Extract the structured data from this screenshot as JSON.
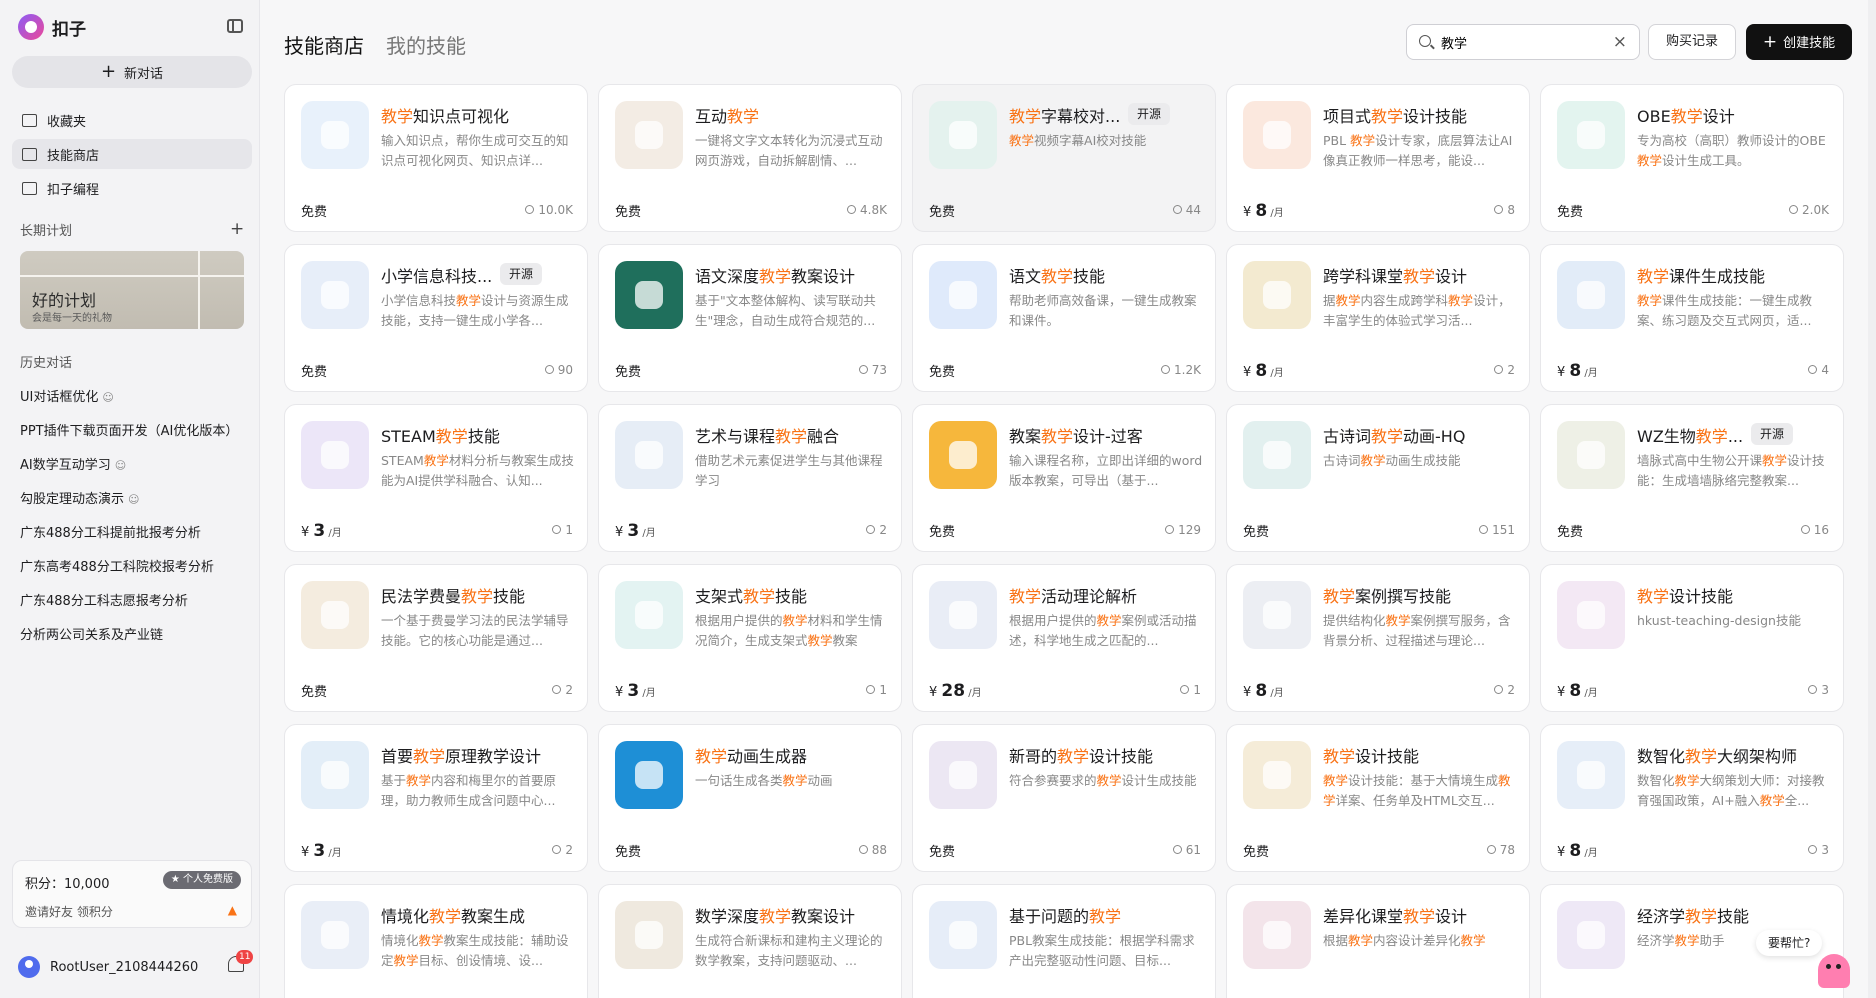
{
  "app": {
    "name": "扣子",
    "new_chat": "新对话"
  },
  "sidebar": {
    "nav": [
      {
        "label": "收藏夹",
        "icon": "folder-icon"
      },
      {
        "label": "技能商店",
        "icon": "books-icon"
      },
      {
        "label": "扣子编程",
        "icon": "code-file-icon"
      }
    ],
    "plan_section": "长期计划",
    "plan_card": {
      "title": "好的计划",
      "subtitle": "会是每一天的礼物"
    },
    "history_section": "历史对话",
    "history": [
      {
        "label": "UI对话框优化",
        "icon": "group-icon"
      },
      {
        "label": "PPT插件下载页面开发（AI优化版本）",
        "icon": ""
      },
      {
        "label": "AI数学互动学习",
        "icon": "group-icon"
      },
      {
        "label": "勾股定理动态演示",
        "icon": "group-icon"
      },
      {
        "label": "广东488分工科提前批报考分析",
        "icon": ""
      },
      {
        "label": "广东高考488分工科院校报考分析",
        "icon": ""
      },
      {
        "label": "广东488分工科志愿报考分析",
        "icon": ""
      },
      {
        "label": "分析两公司关系及产业链",
        "icon": ""
      }
    ],
    "score": {
      "label": "积分：10,000",
      "badge": "★ 个人免费版",
      "invite": "邀请好友 领积分"
    },
    "user": {
      "name": "RootUser_2108444260",
      "notifications": "11"
    }
  },
  "header": {
    "tabs": [
      "技能商店",
      "我的技能"
    ],
    "search": {
      "value": "教学",
      "placeholder": ""
    },
    "purchase_button": "购买记录",
    "create_button": "创建技能"
  },
  "cards": [
    {
      "pre": "",
      "kw": "教学",
      "post": "知识点可视化",
      "tag": "",
      "desc": [
        [
          "",
          "输入知识点，帮你生成可交互的知识点可视化网页、知识点详..."
        ]
      ],
      "price": "免费",
      "users": "10.0K",
      "color": "#e8f1fb",
      "hl": false
    },
    {
      "pre": "互动",
      "kw": "教学",
      "post": "",
      "tag": "",
      "desc": [
        [
          "",
          "一键将文字文本转化为沉浸式互动网页游戏，自动拆解剧情、..."
        ]
      ],
      "price": "免费",
      "users": "4.8K",
      "color": "#f3ece4",
      "hl": false
    },
    {
      "pre": "",
      "kw": "教学",
      "post": "字幕校对...",
      "tag": "开源",
      "desc": [
        [
          "kw",
          "教学"
        ],
        [
          "",
          "视频字幕AI校对技能"
        ]
      ],
      "price": "免费",
      "users": "44",
      "color": "#e4f2ee",
      "hl": true
    },
    {
      "pre": "项目式",
      "kw": "教学",
      "post": "设计技能",
      "tag": "",
      "desc": [
        [
          "",
          "PBL "
        ],
        [
          "kw",
          "教学"
        ],
        [
          "",
          "设计专家，底层算法让AI 像真正教师一样思考，能设..."
        ]
      ],
      "price": "¥|8|/月",
      "users": "8",
      "color": "#fbe8de",
      "hl": false
    },
    {
      "pre": "OBE",
      "kw": "教学",
      "post": "设计",
      "tag": "",
      "desc": [
        [
          "",
          "专为高校（高职）教师设计的OBE"
        ],
        [
          "kw",
          "教学"
        ],
        [
          "",
          "设计生成工具。"
        ]
      ],
      "price": "免费",
      "users": "2.0K",
      "color": "#e3f4ef",
      "hl": false
    },
    {
      "pre": "小学信息科技...",
      "kw": "",
      "post": "",
      "tag": "开源",
      "desc": [
        [
          "",
          "小学信息科技"
        ],
        [
          "kw",
          "教学"
        ],
        [
          "",
          "设计与资源生成技能，支持一键生成小学各..."
        ]
      ],
      "price": "免费",
      "users": "90",
      "color": "#e7eef9",
      "hl": false
    },
    {
      "pre": "语文深度",
      "kw": "教学",
      "post": "教案设计",
      "tag": "",
      "desc": [
        [
          "",
          "基于\"文本整体解构、读写联动共生\"理念，自动生成符合规范的..."
        ]
      ],
      "price": "免费",
      "users": "73",
      "color": "#1f6f5c",
      "hl": false
    },
    {
      "pre": "语文",
      "kw": "教学",
      "post": "技能",
      "tag": "",
      "desc": [
        [
          "",
          "帮助老师高效备课，一键生成教案和课件。"
        ]
      ],
      "price": "免费",
      "users": "1.2K",
      "color": "#dfeafb",
      "hl": false
    },
    {
      "pre": "跨学科课堂",
      "kw": "教学",
      "post": "设计",
      "tag": "",
      "desc": [
        [
          "",
          "据"
        ],
        [
          "kw",
          "教学"
        ],
        [
          "",
          "内容生成跨学科"
        ],
        [
          "kw",
          "教学"
        ],
        [
          "",
          "设计，丰富学生的体验式学习活..."
        ]
      ],
      "price": "¥|8|/月",
      "users": "2",
      "color": "#f3ead0",
      "hl": false
    },
    {
      "pre": "",
      "kw": "教学",
      "post": "课件生成技能",
      "tag": "",
      "desc": [
        [
          "kw",
          "教学"
        ],
        [
          "",
          "课件生成技能：一键生成教案、练习题及交互式网页，适..."
        ]
      ],
      "price": "¥|8|/月",
      "users": "4",
      "color": "#e2ecf8",
      "hl": false
    },
    {
      "pre": "STEAM",
      "kw": "教学",
      "post": "技能",
      "tag": "",
      "desc": [
        [
          "",
          "STEAM"
        ],
        [
          "kw",
          "教学"
        ],
        [
          "",
          "材料分析与教案生成技能为AI提供学科融合、认知..."
        ]
      ],
      "price": "¥|3|/月",
      "users": "1",
      "color": "#ece6f8",
      "hl": false
    },
    {
      "pre": "艺术与课程",
      "kw": "教学",
      "post": "融合",
      "tag": "",
      "desc": [
        [
          "",
          "借助艺术元素促进学生与其他课程学习"
        ]
      ],
      "price": "¥|3|/月",
      "users": "2",
      "color": "#e6edf6",
      "hl": false
    },
    {
      "pre": "教案",
      "kw": "教学",
      "post": "设计-过客",
      "tag": "",
      "desc": [
        [
          "",
          "输入课程名称，立即出详细的word版本教案，可导出（基于..."
        ]
      ],
      "price": "免费",
      "users": "129",
      "color": "#f6b73c",
      "hl": false
    },
    {
      "pre": "古诗词",
      "kw": "教学",
      "post": "动画-HQ",
      "tag": "",
      "desc": [
        [
          "",
          "古诗词"
        ],
        [
          "kw",
          "教学"
        ],
        [
          "",
          "动画生成技能"
        ]
      ],
      "price": "免费",
      "users": "151",
      "color": "#e2f0ef",
      "hl": false
    },
    {
      "pre": "WZ生物",
      "kw": "教学",
      "post": "...",
      "tag": "开源",
      "desc": [
        [
          "",
          "墙脉式高中生物公开课"
        ],
        [
          "kw",
          "教学"
        ],
        [
          "",
          "设计技能：生成墙墙脉络完整教案..."
        ]
      ],
      "price": "免费",
      "users": "16",
      "color": "#eef0e6",
      "hl": false
    },
    {
      "pre": "民法学费曼",
      "kw": "教学",
      "post": "技能",
      "tag": "",
      "desc": [
        [
          "",
          "一个基于费曼学习法的民法学辅导技能。它的核心功能是通过..."
        ]
      ],
      "price": "免费",
      "users": "2",
      "color": "#f4ecdf",
      "hl": false
    },
    {
      "pre": "支架式",
      "kw": "教学",
      "post": "技能",
      "tag": "",
      "desc": [
        [
          "",
          "根据用户提供的"
        ],
        [
          "kw",
          "教学"
        ],
        [
          "",
          "材料和学生情况简介，生成支架式"
        ],
        [
          "kw",
          "教学"
        ],
        [
          "",
          "教案"
        ]
      ],
      "price": "¥|3|/月",
      "users": "1",
      "color": "#e3f3f2",
      "hl": false
    },
    {
      "pre": "",
      "kw": "教学",
      "post": "活动理论解析",
      "tag": "",
      "desc": [
        [
          "",
          "根据用户提供的"
        ],
        [
          "kw",
          "教学"
        ],
        [
          "",
          "案例或活动描述，科学地生成之匹配的..."
        ]
      ],
      "price": "¥|28|/月",
      "users": "1",
      "color": "#e9edf6",
      "hl": false
    },
    {
      "pre": "",
      "kw": "教学",
      "post": "案例撰写技能",
      "tag": "",
      "desc": [
        [
          "",
          "提供结构化"
        ],
        [
          "kw",
          "教学"
        ],
        [
          "",
          "案例撰写服务，含背景分析、过程描述与理论..."
        ]
      ],
      "price": "¥|8|/月",
      "users": "2",
      "color": "#eceef3",
      "hl": false
    },
    {
      "pre": "",
      "kw": "教学",
      "post": "设计技能",
      "tag": "",
      "desc": [
        [
          "",
          "hkust-teaching-design技能"
        ]
      ],
      "price": "¥|8|/月",
      "users": "3",
      "color": "#f3e8f4",
      "hl": false
    },
    {
      "pre": "首要",
      "kw": "教学",
      "post": "原理教学设计",
      "tag": "",
      "desc": [
        [
          "",
          "基于"
        ],
        [
          "kw",
          "教学"
        ],
        [
          "",
          "内容和梅里尔的首要原理，助力教师生成含问题中心..."
        ]
      ],
      "price": "¥|3|/月",
      "users": "2",
      "color": "#e3eef8",
      "hl": false
    },
    {
      "pre": "",
      "kw": "教学",
      "post": "动画生成器",
      "tag": "",
      "desc": [
        [
          "",
          "一句话生成各类"
        ],
        [
          "kw",
          "教学"
        ],
        [
          "",
          "动画"
        ]
      ],
      "price": "免费",
      "users": "88",
      "color": "#1e8fd6",
      "hl": false
    },
    {
      "pre": "新哥的",
      "kw": "教学",
      "post": "设计技能",
      "tag": "",
      "desc": [
        [
          "",
          "符合参赛要求的"
        ],
        [
          "kw",
          "教学"
        ],
        [
          "",
          "设计生成技能"
        ]
      ],
      "price": "免费",
      "users": "61",
      "color": "#ece7f3",
      "hl": false
    },
    {
      "pre": "",
      "kw": "教学",
      "post": "设计技能",
      "tag": "",
      "desc": [
        [
          "kw",
          "教学"
        ],
        [
          "",
          "设计技能：基于大情境生成"
        ],
        [
          "kw",
          "教学"
        ],
        [
          "",
          "详案、任务单及HTML交互..."
        ]
      ],
      "price": "免费",
      "users": "78",
      "color": "#f5ecd8",
      "hl": false
    },
    {
      "pre": "数智化",
      "kw": "教学",
      "post": "大纲架构师",
      "tag": "",
      "desc": [
        [
          "",
          "数智化"
        ],
        [
          "kw",
          "教学"
        ],
        [
          "",
          "大纲策划大师：对接教育强国政策，AI+融入"
        ],
        [
          "kw",
          "教学"
        ],
        [
          "",
          "全..."
        ]
      ],
      "price": "¥|8|/月",
      "users": "3",
      "color": "#e6eef8",
      "hl": false
    },
    {
      "pre": "情境化",
      "kw": "教学",
      "post": "教案生成",
      "tag": "",
      "desc": [
        [
          "",
          "情境化"
        ],
        [
          "kw",
          "教学"
        ],
        [
          "",
          "教案生成技能：辅助设定"
        ],
        [
          "kw",
          "教学"
        ],
        [
          "",
          "目标、创设情境、设..."
        ]
      ],
      "price": "",
      "users": "",
      "color": "#e9eef7",
      "hl": false
    },
    {
      "pre": "数学深度",
      "kw": "教学",
      "post": "教案设计",
      "tag": "",
      "desc": [
        [
          "",
          "生成符合新课标和建构主义理论的数学教案，支持问题驱动、..."
        ]
      ],
      "price": "",
      "users": "",
      "color": "#efe9df",
      "hl": false
    },
    {
      "pre": "基于问题的",
      "kw": "教学",
      "post": "",
      "tag": "",
      "desc": [
        [
          "",
          "PBL教案生成技能：根据学科需求产出完整驱动性问题、目标..."
        ]
      ],
      "price": "",
      "users": "",
      "color": "#e6edf8",
      "hl": false
    },
    {
      "pre": "差异化课堂",
      "kw": "教学",
      "post": "设计",
      "tag": "",
      "desc": [
        [
          "",
          "根据"
        ],
        [
          "kw",
          "教学"
        ],
        [
          "",
          "内容设计差异化"
        ],
        [
          "kw",
          "教学"
        ]
      ],
      "price": "",
      "users": "",
      "color": "#f3e4ea",
      "hl": false
    },
    {
      "pre": "经济学",
      "kw": "教学",
      "post": "技能",
      "tag": "",
      "desc": [
        [
          "",
          "经济学"
        ],
        [
          "kw",
          "教学"
        ],
        [
          "",
          "助手"
        ]
      ],
      "price": "",
      "users": "",
      "color": "#eee8f6",
      "hl": false
    }
  ],
  "help": {
    "label": "要帮忙?"
  }
}
